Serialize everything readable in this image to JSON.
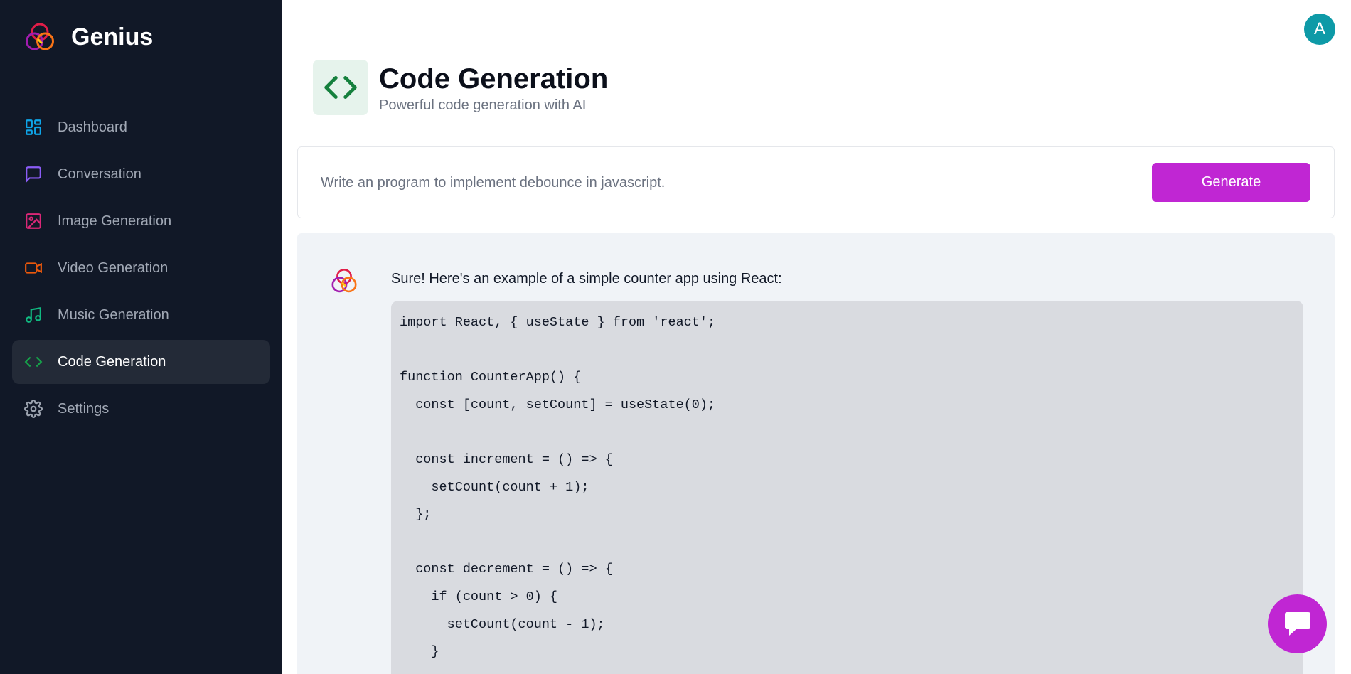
{
  "app": {
    "name": "Genius"
  },
  "sidebar": {
    "items": [
      {
        "label": "Dashboard",
        "icon": "dashboard-icon",
        "color": "#0ea5e9"
      },
      {
        "label": "Conversation",
        "icon": "message-square-icon",
        "color": "#8b5cf6"
      },
      {
        "label": "Image Generation",
        "icon": "image-icon",
        "color": "#db2777"
      },
      {
        "label": "Video Generation",
        "icon": "video-icon",
        "color": "#ea580c"
      },
      {
        "label": "Music Generation",
        "icon": "music-icon",
        "color": "#10b981"
      },
      {
        "label": "Code Generation",
        "icon": "code-icon",
        "color": "#15803d",
        "active": true
      },
      {
        "label": "Settings",
        "icon": "settings-icon",
        "color": "#9ca3af"
      }
    ]
  },
  "header": {
    "avatar_initial": "A"
  },
  "page": {
    "title": "Code Generation",
    "subtitle": "Powerful code generation with AI",
    "icon": "code-icon"
  },
  "prompt": {
    "placeholder": "Write an program to implement debounce in javascript.",
    "value": "",
    "generate_label": "Generate"
  },
  "response": {
    "intro": "Sure! Here's an example of a simple counter app using React:",
    "code_lines": [
      "import React, { useState } from 'react';",
      "",
      "function CounterApp() {",
      "  const [count, setCount] = useState(0);",
      "",
      "  const increment = () => {",
      "    setCount(count + 1);",
      "  };",
      "",
      "  const decrement = () => {",
      "    if (count > 0) {",
      "      setCount(count - 1);",
      "    }"
    ]
  },
  "colors": {
    "sidebar_bg": "#111827",
    "accent": "#c026d3",
    "avatar": "#0e9aa7",
    "code_green": "#15803d"
  }
}
